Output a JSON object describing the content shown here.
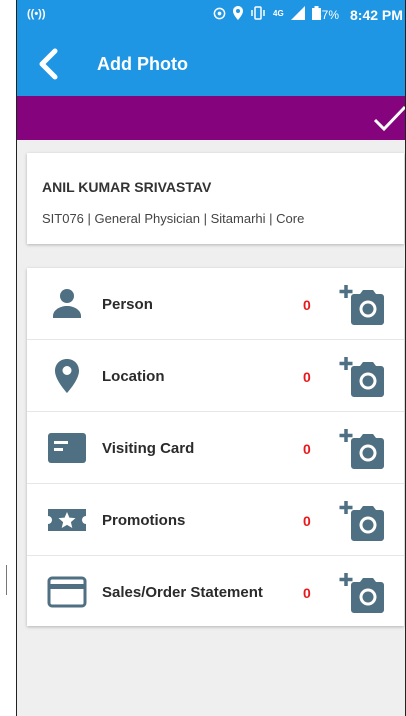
{
  "status_bar": {
    "battery": "67%",
    "time": "8:42 PM",
    "network": "4G"
  },
  "app_bar": {
    "title": "Add Photo"
  },
  "doctor": {
    "name": "ANIL KUMAR SRIVASTAV",
    "details": "SIT076 | General Physician | Sitamarhi | Core"
  },
  "photo_categories": [
    {
      "label": "Person",
      "count": "0",
      "icon": "person-icon"
    },
    {
      "label": "Location",
      "count": "0",
      "icon": "location-pin-icon"
    },
    {
      "label": "Visiting Card",
      "count": "0",
      "icon": "visiting-card-icon"
    },
    {
      "label": "Promotions",
      "count": "0",
      "icon": "promotions-ticket-icon"
    },
    {
      "label": "Sales/Order Statement",
      "count": "0",
      "icon": "credit-card-icon"
    }
  ],
  "colors": {
    "primary": "#1f96e4",
    "accent_bar": "#85047d",
    "count": "#e8181c",
    "icon": "#4f6f82"
  }
}
